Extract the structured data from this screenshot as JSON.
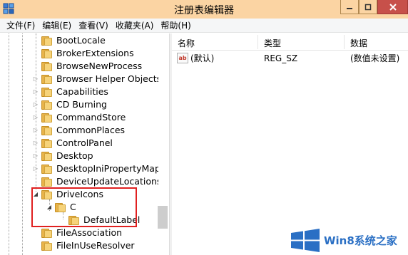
{
  "window": {
    "title": "注册表编辑器",
    "icons": {
      "app": "registry-editor-icon",
      "minimize": "minimize-icon",
      "maximize": "maximize-icon",
      "close": "close-icon"
    }
  },
  "menu": [
    "文件(F)",
    "编辑(E)",
    "查看(V)",
    "收藏夹(A)",
    "帮助(H)"
  ],
  "tree": {
    "items": [
      {
        "label": "BootLocale",
        "expander": ""
      },
      {
        "label": "BrokerExtensions",
        "expander": ""
      },
      {
        "label": "BrowseNewProcess",
        "expander": ""
      },
      {
        "label": "Browser Helper Objects",
        "expander": "▷"
      },
      {
        "label": "Capabilities",
        "expander": "▷"
      },
      {
        "label": "CD Burning",
        "expander": "▷"
      },
      {
        "label": "CommandStore",
        "expander": "▷"
      },
      {
        "label": "CommonPlaces",
        "expander": "▷"
      },
      {
        "label": "ControlPanel",
        "expander": "▷"
      },
      {
        "label": "Desktop",
        "expander": "▷"
      },
      {
        "label": "DesktopIniPropertyMap",
        "expander": "▷"
      },
      {
        "label": "DeviceUpdateLocations",
        "expander": ""
      },
      {
        "label": "DriveIcons",
        "expander": "◢"
      },
      {
        "label": "C",
        "expander": "◢"
      },
      {
        "label": "DefaultLabel",
        "expander": ""
      },
      {
        "label": "FileAssociation",
        "expander": ""
      },
      {
        "label": "FileInUseResolver",
        "expander": ""
      }
    ]
  },
  "list": {
    "columns": [
      "名称",
      "类型",
      "数据"
    ],
    "rows": [
      {
        "name": "(默认)",
        "type": "REG_SZ",
        "data": "(数值未设置)",
        "icon": "string-value-icon",
        "icon_text": "ab"
      }
    ]
  },
  "watermark": {
    "text": "Win8系统之家",
    "icon": "windows-logo-icon"
  },
  "colors": {
    "titlebar": "#fbd4a3",
    "close": "#c7504a",
    "highlight_box": "#e02020",
    "watermark": "#2a6fc4"
  }
}
